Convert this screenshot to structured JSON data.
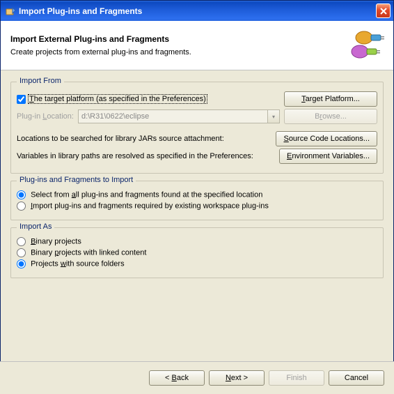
{
  "titlebar": {
    "text": "Import Plug-ins and Fragments"
  },
  "header": {
    "title": "Import External Plug-ins and Fragments",
    "desc": "Create projects from external plug-ins and fragments."
  },
  "import_from": {
    "legend": "Import From",
    "target_checkbox_label": "The target platform (as specified in the Preferences)",
    "target_checked": true,
    "location_label": "Plug-in Location:",
    "location_value": "d:\\R31\\0622\\eclipse",
    "target_platform_btn": "Target Platform...",
    "browse_btn": "Browse...",
    "source_label": "Locations to be searched for library JARs source attachment:",
    "source_btn": "Source Code Locations...",
    "vars_label": "Variables in library paths are resolved as specified in the Preferences:",
    "vars_btn": "Environment Variables..."
  },
  "to_import": {
    "legend": "Plug-ins and Fragments to Import",
    "opt1": "Select from all plug-ins and fragments found at the specified location",
    "opt2": "Import plug-ins and fragments required by existing workspace plug-ins",
    "selected": "opt1"
  },
  "import_as": {
    "legend": "Import As",
    "opt1": "Binary projects",
    "opt2": "Binary projects with linked content",
    "opt3": "Projects with source folders",
    "selected": "opt3"
  },
  "footer": {
    "back": "< Back",
    "next": "Next >",
    "finish": "Finish",
    "cancel": "Cancel"
  }
}
